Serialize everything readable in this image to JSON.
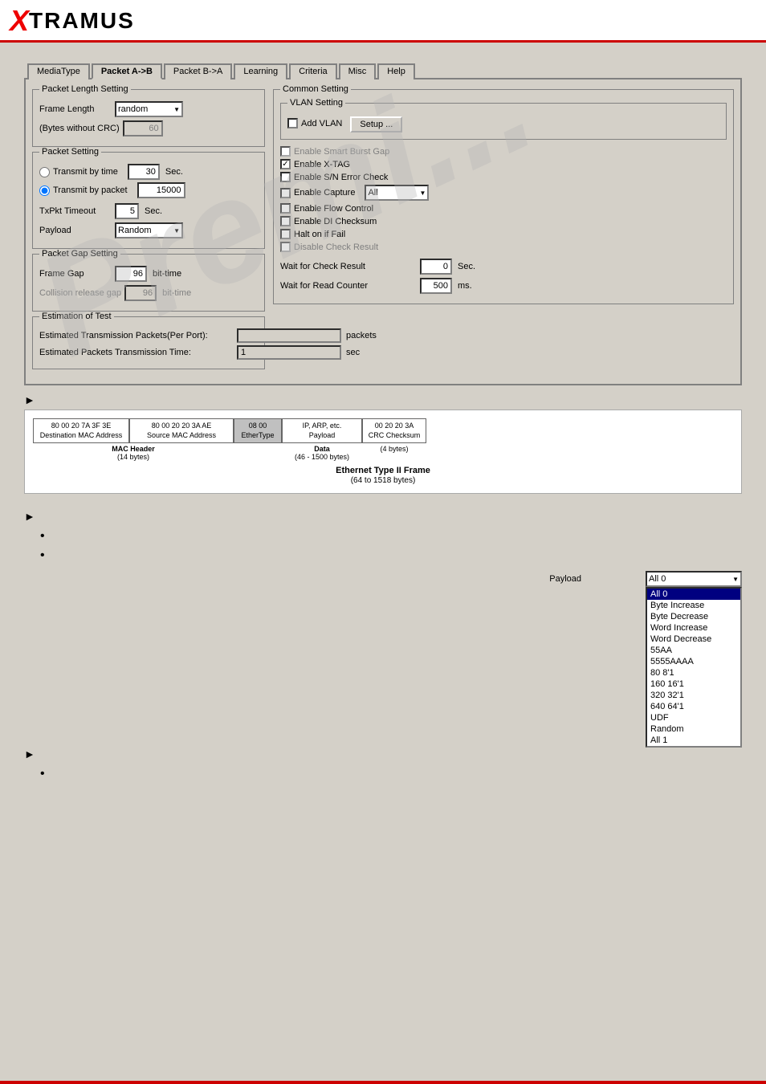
{
  "header": {
    "logo_x": "X",
    "logo_tramus": "TRAMUS"
  },
  "tabs": {
    "items": [
      "MediaType",
      "Packet A->B",
      "Packet B->A",
      "Learning",
      "Criteria",
      "Misc",
      "Help"
    ],
    "active": "Packet A->B"
  },
  "packet_length": {
    "group_label": "Packet Length Setting",
    "frame_length_label": "Frame Length",
    "frame_length_value": "random",
    "bytes_label": "(Bytes without CRC)",
    "bytes_value": "60"
  },
  "packet_setting": {
    "group_label": "Packet Setting",
    "transmit_time_label": "Transmit by time",
    "transmit_time_value": "30",
    "transmit_time_unit": "Sec.",
    "transmit_packet_label": "Transmit by packet",
    "transmit_packet_value": "15000",
    "txpkt_timeout_label": "TxPkt Timeout",
    "txpkt_timeout_value": "5",
    "txpkt_timeout_unit": "Sec.",
    "payload_label": "Payload",
    "payload_value": "Random"
  },
  "packet_gap": {
    "group_label": "Packet Gap Setting",
    "frame_gap_label": "Frame Gap",
    "frame_gap_value": "96",
    "frame_gap_unit": "bit-time",
    "collision_gap_label": "Collision release gap",
    "collision_gap_value": "96",
    "collision_gap_unit": "bit-time"
  },
  "estimation": {
    "group_label": "Estimation of Test",
    "packets_label": "Estimated Transmission Packets(Per Port):",
    "packets_unit": "packets",
    "time_label": "Estimated Packets Transmission Time:",
    "time_value": "1",
    "time_unit": "sec"
  },
  "common_setting": {
    "group_label": "Common Setting",
    "vlan_group": "VLAN Setting",
    "add_vlan_label": "Add VLAN",
    "setup_label": "Setup ...",
    "enable_smart_burst": "Enable Smart Burst Gap",
    "enable_xtag": "Enable X-TAG",
    "enable_sn_error": "Enable S/N Error Check",
    "enable_capture": "Enable Capture",
    "capture_value": "All",
    "enable_flow_control": "Enable Flow Control",
    "enable_di_checksum": "Enable DI Checksum",
    "halt_on_fail": "Halt on if Fail",
    "disable_check_result": "Disable Check Result",
    "wait_check_label": "Wait for Check Result",
    "wait_check_value": "0",
    "wait_check_unit": "Sec.",
    "wait_read_label": "Wait for Read Counter",
    "wait_read_value": "500",
    "wait_read_unit": "ms."
  },
  "frame_diagram": {
    "dest_hex": "80 00 20 7A 3F 3E",
    "dest_label": "Destination MAC Address",
    "src_hex": "80 00 20 20 3A AE",
    "src_label": "Source MAC Address",
    "etype_hex": "08 00",
    "etype_label": "EtherType",
    "payload_hex": "IP, ARP, etc.",
    "payload_label": "Payload",
    "crc_hex": "00 20 20 3A",
    "crc_label": "CRC Checksum",
    "mac_header_label": "MAC Header",
    "mac_header_bytes": "(14 bytes)",
    "data_label": "Data",
    "data_bytes": "(46 - 1500 bytes)",
    "crc_bytes": "(4 bytes)",
    "frame_title": "Ethernet Type II Frame",
    "frame_subtitle": "(64 to 1518 bytes)"
  },
  "payload_section": {
    "label": "Payload",
    "selected": "All 0",
    "options": [
      "All 0",
      "Byte Increase",
      "Byte Decrease",
      "Word Increase",
      "Word Decrease",
      "55AA",
      "5555AAAA",
      "80 8'1",
      "160 16'1",
      "320 32'1",
      "640 64'1",
      "UDF",
      "Random",
      "All 1"
    ]
  },
  "bullets": {
    "arrow1_text": "",
    "bullet1": "",
    "bullet2": "",
    "arrow2_text": "",
    "bullet3": ""
  },
  "watermark": "Premi..."
}
